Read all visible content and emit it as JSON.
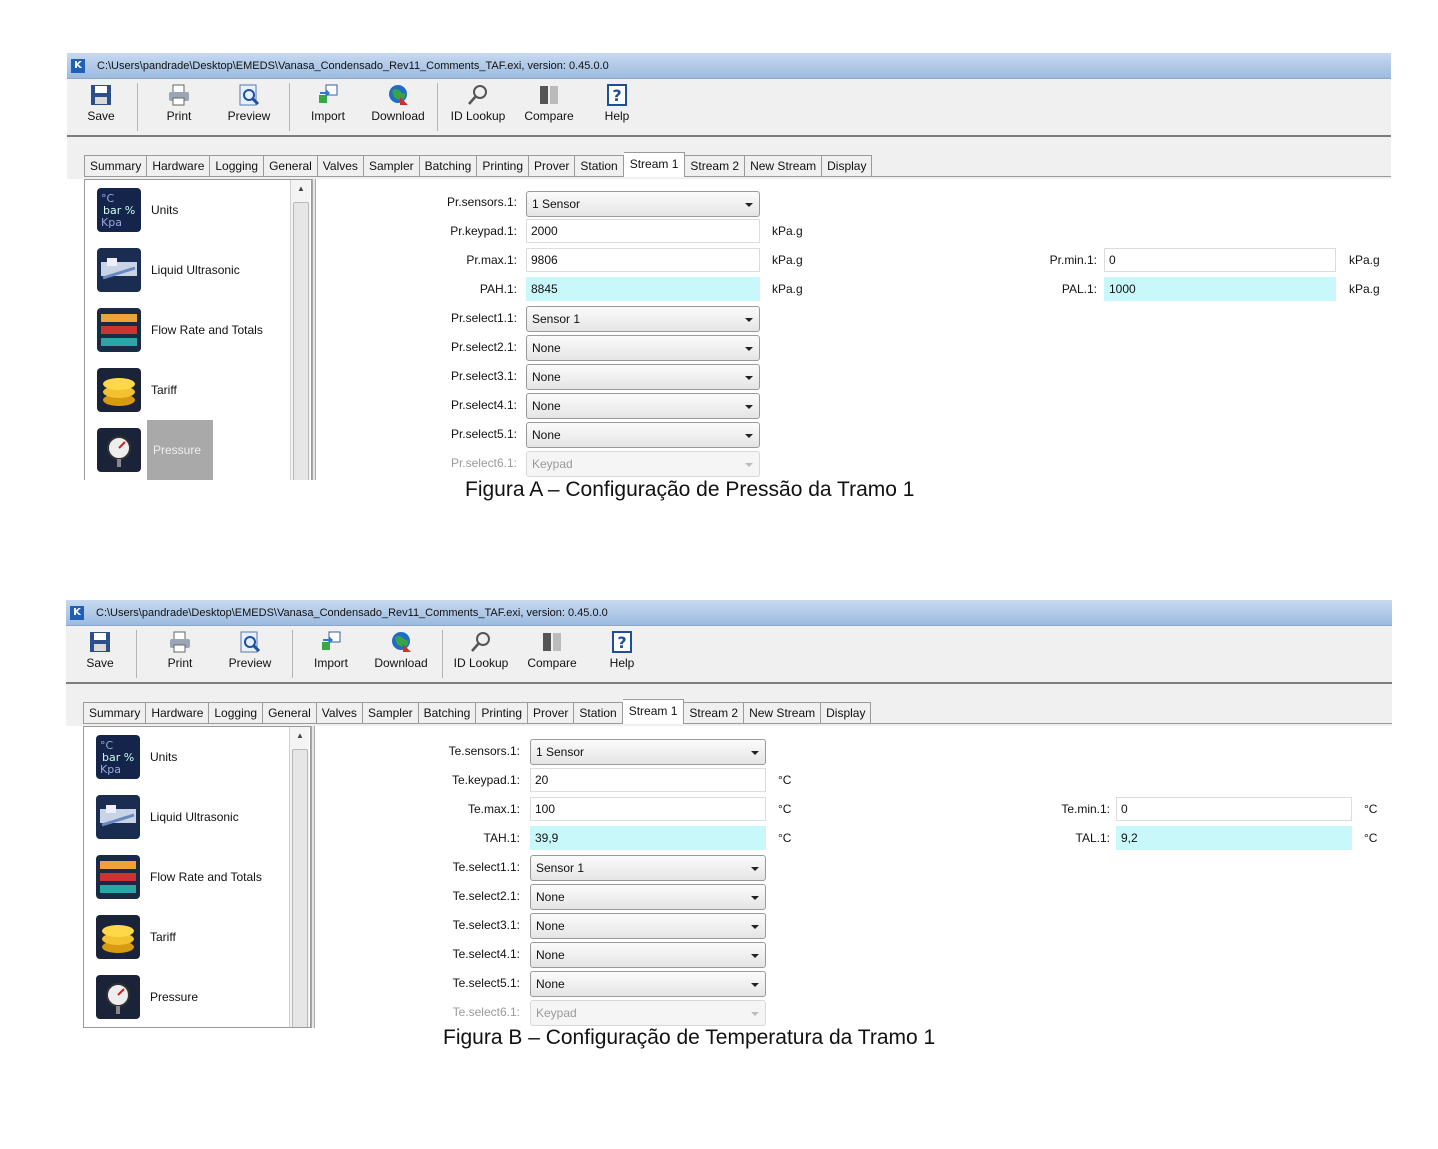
{
  "window_title": "C:\\Users\\pandrade\\Desktop\\EMEDS\\Vanasa_Condensado_Rev11_Comments_TAF.exi, version: 0.45.0.0",
  "app_icon_letter": "K",
  "toolbar": {
    "save": "Save",
    "print": "Print",
    "preview": "Preview",
    "import": "Import",
    "download": "Download",
    "id_lookup": "ID Lookup",
    "compare": "Compare",
    "help": "Help"
  },
  "tabs": [
    "Summary",
    "Hardware",
    "Logging",
    "General",
    "Valves",
    "Sampler",
    "Batching",
    "Printing",
    "Prover",
    "Station",
    "Stream 1",
    "Stream 2",
    "New Stream",
    "Display"
  ],
  "active_tab": "Stream 1",
  "sidebar": {
    "items": [
      "Units",
      "Liquid Ultrasonic",
      "Flow Rate and Totals",
      "Tariff",
      "Pressure"
    ],
    "units_icon_text": "°C bar % Kpa"
  },
  "figA": {
    "fields": {
      "sensors_label": "Pr.sensors.1:",
      "sensors_value": "1 Sensor",
      "keypad_label": "Pr.keypad.1:",
      "keypad_value": "2000",
      "max_label": "Pr.max.1:",
      "max_value": "9806",
      "pah_label": "PAH.1:",
      "pah_value": "8845",
      "min_label": "Pr.min.1:",
      "min_value": "0",
      "pal_label": "PAL.1:",
      "pal_value": "1000",
      "unit": "kPa.g",
      "select1_label": "Pr.select1.1:",
      "select1_value": "Sensor 1",
      "select2_label": "Pr.select2.1:",
      "select2_value": "None",
      "select3_label": "Pr.select3.1:",
      "select3_value": "None",
      "select4_label": "Pr.select4.1:",
      "select4_value": "None",
      "select5_label": "Pr.select5.1:",
      "select5_value": "None",
      "select6_label": "Pr.select6.1:",
      "select6_value": "Keypad"
    },
    "caption": "Figura A – Configuração de Pressão da Tramo 1"
  },
  "figB": {
    "fields": {
      "sensors_label": "Te.sensors.1:",
      "sensors_value": "1 Sensor",
      "keypad_label": "Te.keypad.1:",
      "keypad_value": "20",
      "max_label": "Te.max.1:",
      "max_value": "100",
      "tah_label": "TAH.1:",
      "tah_value": "39,9",
      "min_label": "Te.min.1:",
      "min_value": "0",
      "tal_label": "TAL.1:",
      "tal_value": "9,2",
      "unit": "°C",
      "select1_label": "Te.select1.1:",
      "select1_value": "Sensor 1",
      "select2_label": "Te.select2.1:",
      "select2_value": "None",
      "select3_label": "Te.select3.1:",
      "select3_value": "None",
      "select4_label": "Te.select4.1:",
      "select4_value": "None",
      "select5_label": "Te.select5.1:",
      "select5_value": "None",
      "select6_label": "Te.select6.1:",
      "select6_value": "Keypad"
    },
    "caption": "Figura B – Configuração de Temperatura da Tramo 1"
  },
  "colors": {
    "titlebar": "#9cbbe0",
    "alarm_field": "#c9f8fb",
    "selected_side": "#a9a9a9"
  }
}
